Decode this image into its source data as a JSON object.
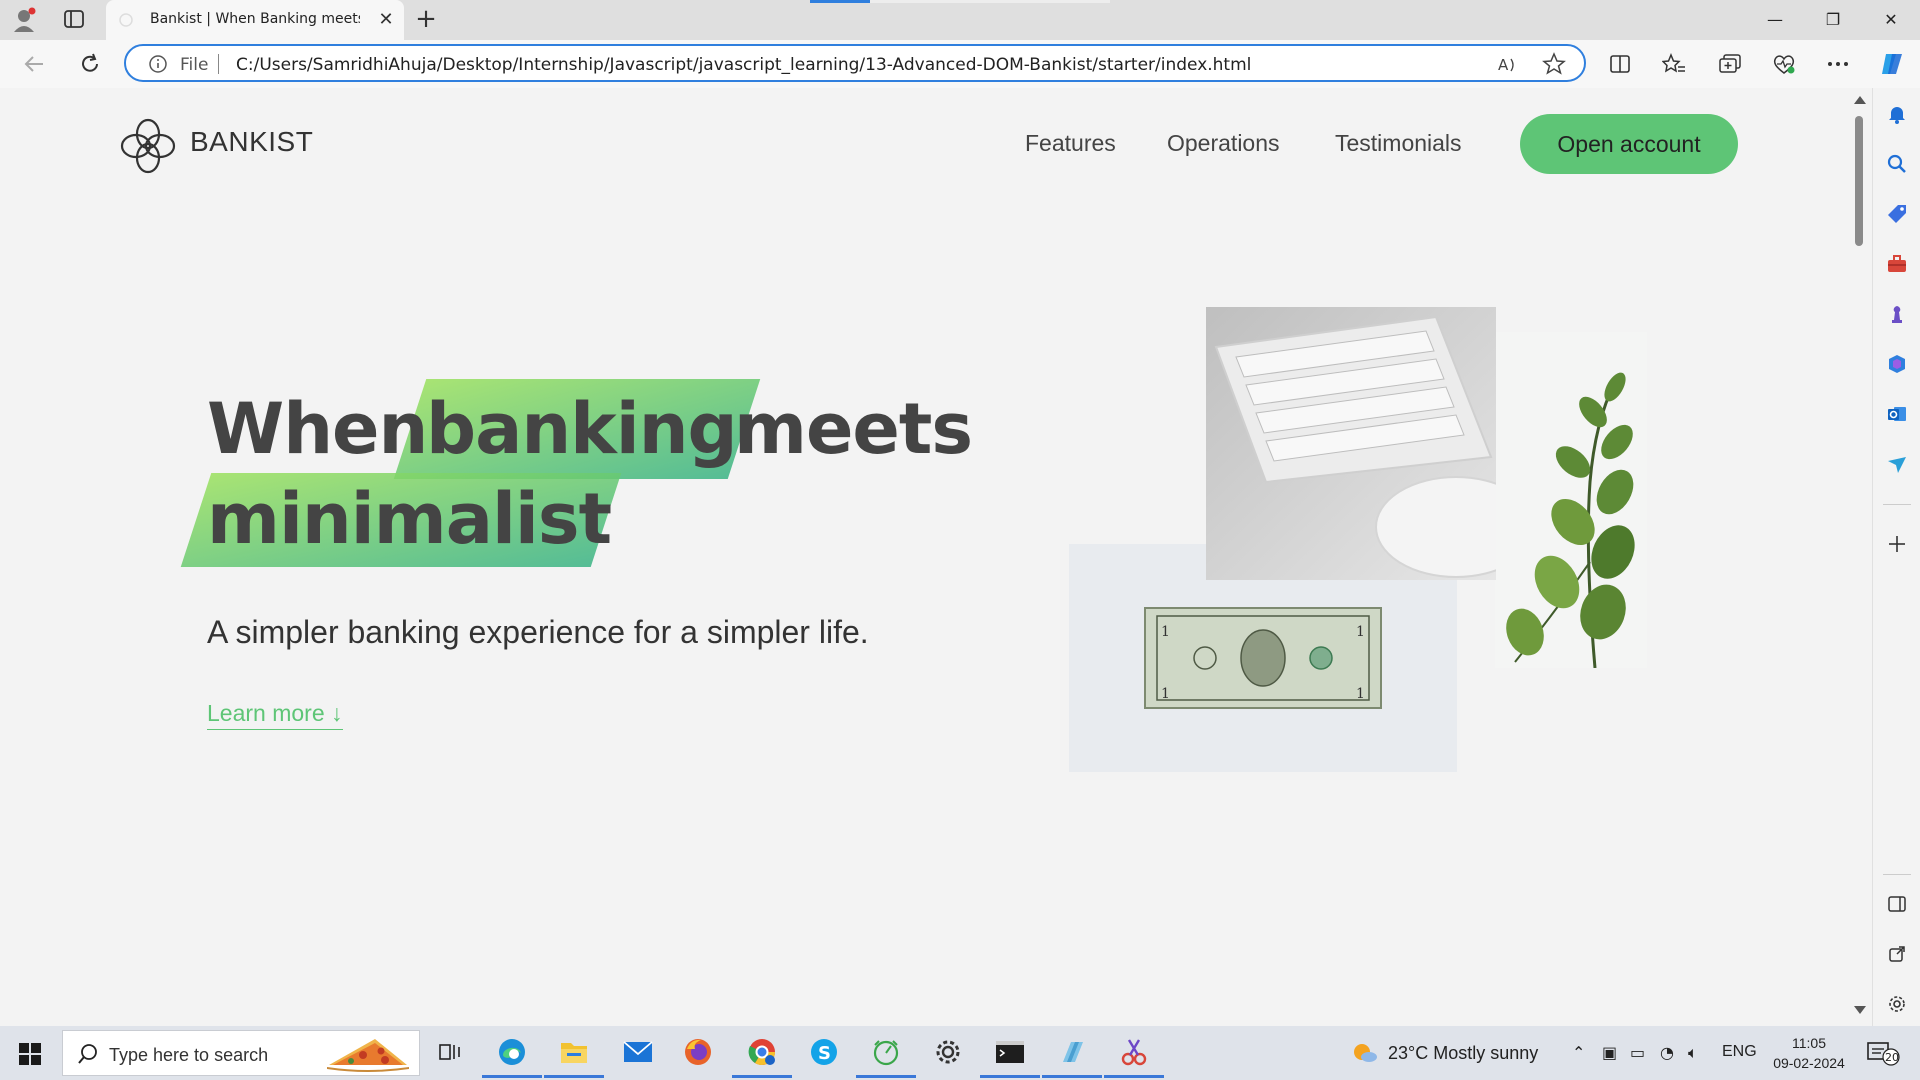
{
  "browser": {
    "tab_title": "Bankist | When Banking meets M",
    "url_scheme_label": "File",
    "url": "C:/Users/SamridhiAhuja/Desktop/Internship/Javascript/javascript_learning/13-Advanced-DOM-Bankist/starter/index.html",
    "accent_color": "#2f7fde"
  },
  "page": {
    "brand": "BANKIST",
    "nav": {
      "features": "Features",
      "operations": "Operations",
      "testimonials": "Testimonials",
      "open_account": "Open account"
    },
    "hero": {
      "line1_word1": "When",
      "line1_highlight": "banking",
      "line1_word3": "meets",
      "line2_highlight": "minimalist",
      "subtitle": "A simpler banking experience for a simpler life.",
      "learn_more": "Learn more ↓"
    },
    "colors": {
      "primary": "#5ec576",
      "gradient_start": "#9be15d",
      "gradient_end": "#39b385"
    },
    "images": [
      "keyboard-mouse-photo",
      "dollar-bill-photo",
      "eucalyptus-plant-photo"
    ]
  },
  "taskbar": {
    "search_placeholder": "Type here to search",
    "weather": "23°C  Mostly sunny",
    "language": "ENG",
    "time": "11:05",
    "date": "09-02-2024",
    "notification_count": "20"
  }
}
